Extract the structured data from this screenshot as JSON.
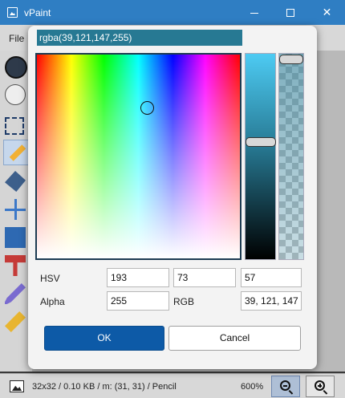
{
  "window": {
    "title": "vPaint",
    "minimize_label": "",
    "maximize_label": "",
    "close_label": "✕"
  },
  "menubar": {
    "file": "File"
  },
  "statusbar": {
    "info": "32x32 / 0.10 KB / m: (31, 31) / Pencil",
    "zoom": "600%"
  },
  "dialog": {
    "color_value": "rgba(39,121,147,255)",
    "hsv_label": "HSV",
    "alpha_label": "Alpha",
    "rgb_label": "RGB",
    "hue": "193",
    "saturation": "73",
    "value": "57",
    "alpha": "255",
    "rgb": "39, 121, 147",
    "ok_label": "OK",
    "cancel_label": "Cancel",
    "current_color": "#277993"
  },
  "tools": [
    "pencil",
    "fill",
    "move",
    "resize",
    "stamp",
    "picker",
    "eraser"
  ]
}
